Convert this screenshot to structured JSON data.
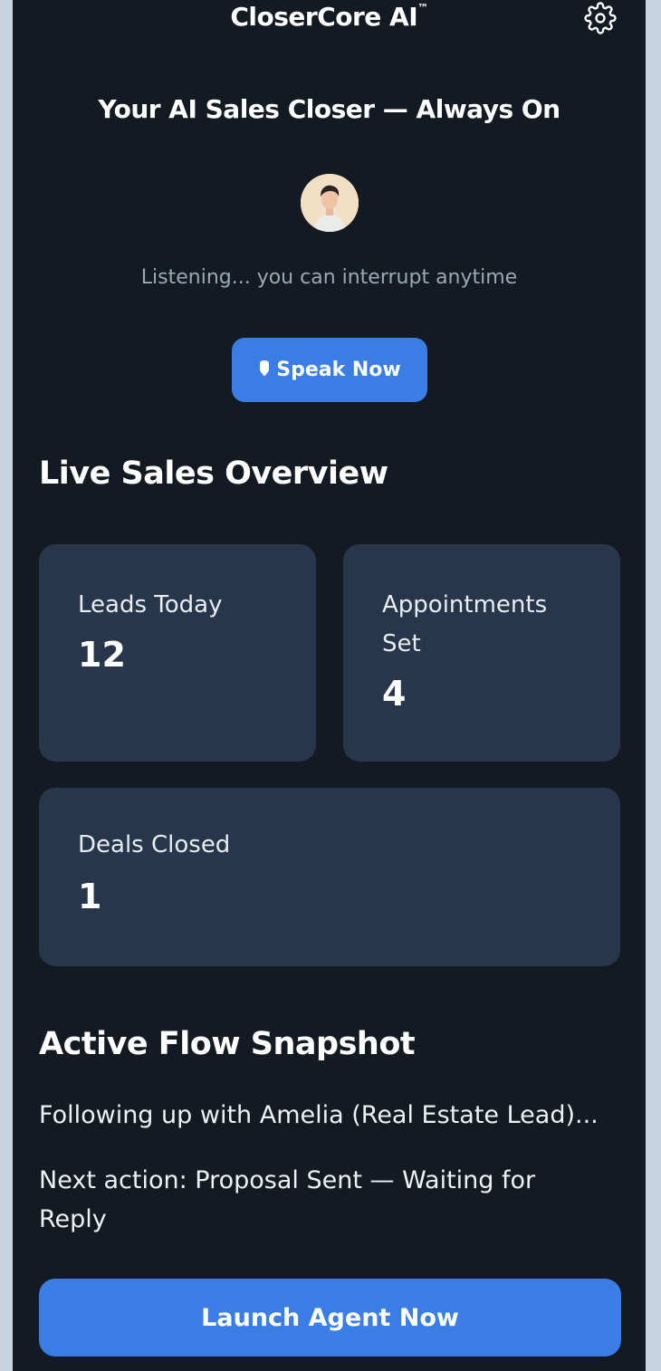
{
  "header": {
    "title": "CloserCore AI",
    "trademark": "™",
    "settings_icon": "gear-icon"
  },
  "hero": {
    "title": "Your AI Sales Closer — Always On",
    "avatar": "avatar-icon",
    "status": "Listening... you can interrupt anytime",
    "speak_button": "Speak Now",
    "speak_icon": "mic-icon"
  },
  "overview": {
    "title": "Live Sales Overview",
    "cards": [
      {
        "label": "Leads Today",
        "value": "12"
      },
      {
        "label": "Appointments Set",
        "value": "4"
      },
      {
        "label": "Deals Closed",
        "value": "1"
      }
    ]
  },
  "flow": {
    "title": "Active Flow Snapshot",
    "current": "Following up with Amelia (Real Estate Lead)...",
    "next_action": "Next action: Proposal Sent — Waiting for Reply"
  },
  "cta": {
    "launch_button": "Launch Agent Now"
  },
  "colors": {
    "background": "#141a21",
    "card": "#27364a",
    "accent": "#3a7ee5",
    "muted_text": "#9aa8b8"
  }
}
